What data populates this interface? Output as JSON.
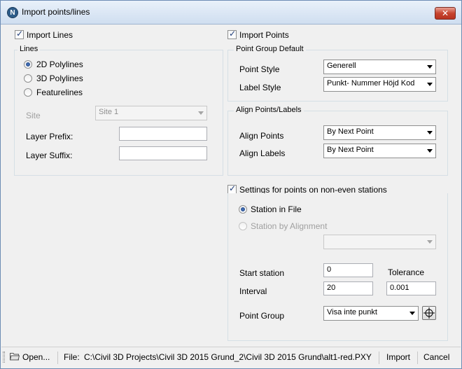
{
  "window": {
    "title": "Import points/lines",
    "close_glyph": "✕"
  },
  "icons": {
    "app": "N"
  },
  "lines_section": {
    "import_checkbox": {
      "label": "Import Lines",
      "checked": true
    },
    "group_title": "Lines",
    "radios": [
      {
        "label": "2D Polylines",
        "checked": true
      },
      {
        "label": "3D Polylines",
        "checked": false
      },
      {
        "label": "Featurelines",
        "checked": false
      }
    ],
    "site": {
      "label": "Site",
      "value": "Site 1"
    },
    "layer_prefix": {
      "label": "Layer Prefix:",
      "value": ""
    },
    "layer_suffix": {
      "label": "Layer Suffix:",
      "value": ""
    }
  },
  "points_section": {
    "import_checkbox": {
      "label": "Import Points",
      "checked": true
    },
    "point_group_default": {
      "title": "Point Group Default",
      "point_style": {
        "label": "Point Style",
        "value": "Generell"
      },
      "label_style": {
        "label": "Label Style",
        "value": "Punkt- Nummer Höjd Kod"
      }
    },
    "align": {
      "title": "Align Points/Labels",
      "align_points": {
        "label": "Align Points",
        "value": "By Next Point"
      },
      "align_labels": {
        "label": "Align Labels",
        "value": "By Next Point"
      }
    },
    "stations": {
      "checkbox": {
        "label": "Settings for points on non-even stations",
        "checked": true
      },
      "station_in_file": {
        "label": "Station in File",
        "checked": true
      },
      "station_by_alignment": {
        "label": "Station by Alignment",
        "checked": false
      },
      "alignment_value": "",
      "start_station": {
        "label": "Start station",
        "value": "0"
      },
      "tolerance": {
        "label": "Tolerance",
        "value": "0.001"
      },
      "interval": {
        "label": "Interval",
        "value": "20"
      },
      "point_group": {
        "label": "Point Group",
        "value": "Visa inte punkt"
      }
    }
  },
  "statusbar": {
    "open_label": "Open...",
    "file_label": "File:",
    "file_path": "C:\\Civil 3D Projects\\Civil 3D 2015 Grund_2\\Civil 3D 2015 Grund\\alt1-red.PXY",
    "import_label": "Import",
    "cancel_label": "Cancel"
  }
}
